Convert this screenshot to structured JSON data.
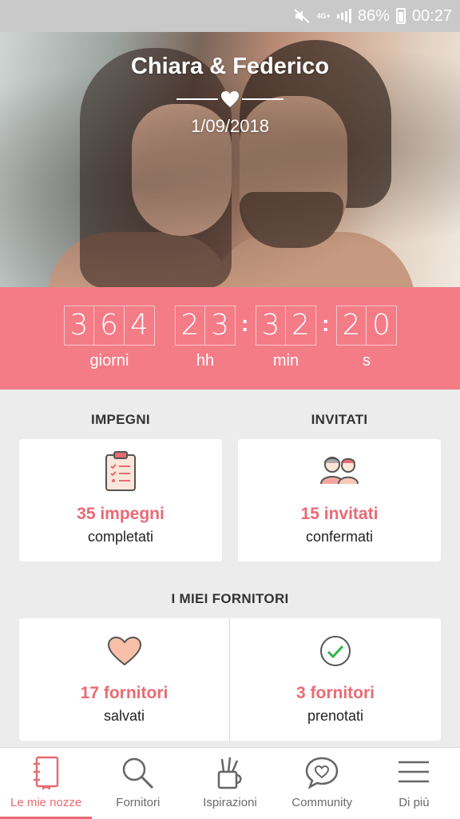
{
  "status_bar": {
    "network": "4G+",
    "battery": "86%",
    "time": "00:27"
  },
  "hero": {
    "couple": "Chiara & Federico",
    "date": "1/09/2018"
  },
  "countdown": {
    "days": [
      "3",
      "6",
      "4"
    ],
    "hours": [
      "2",
      "3"
    ],
    "minutes": [
      "3",
      "2"
    ],
    "seconds": [
      "2",
      "0"
    ],
    "labels": {
      "days": "giorni",
      "hours": "hh",
      "minutes": "min",
      "seconds": "s"
    }
  },
  "impegni": {
    "title": "IMPEGNI",
    "count": "35 impegni",
    "sub": "completati"
  },
  "invitati": {
    "title": "INVITATI",
    "count": "15 invitati",
    "sub": "confermati"
  },
  "fornitori": {
    "title": "I MIEI FORNITORI",
    "saved_count": "17 fornitori",
    "saved_sub": "salvati",
    "booked_count": "3 fornitori",
    "booked_sub": "prenotati"
  },
  "nav": {
    "items": [
      {
        "label": "Le mie nozze",
        "icon": "notebook-icon",
        "active": true
      },
      {
        "label": "Fornitori",
        "icon": "search-icon",
        "active": false
      },
      {
        "label": "Ispirazioni",
        "icon": "pencil-cup-icon",
        "active": false
      },
      {
        "label": "Community",
        "icon": "chat-heart-icon",
        "active": false
      },
      {
        "label": "Di più",
        "icon": "menu-icon",
        "active": false
      }
    ]
  },
  "colors": {
    "accent": "#e96a74",
    "countdown_bg": "#f47c87"
  }
}
